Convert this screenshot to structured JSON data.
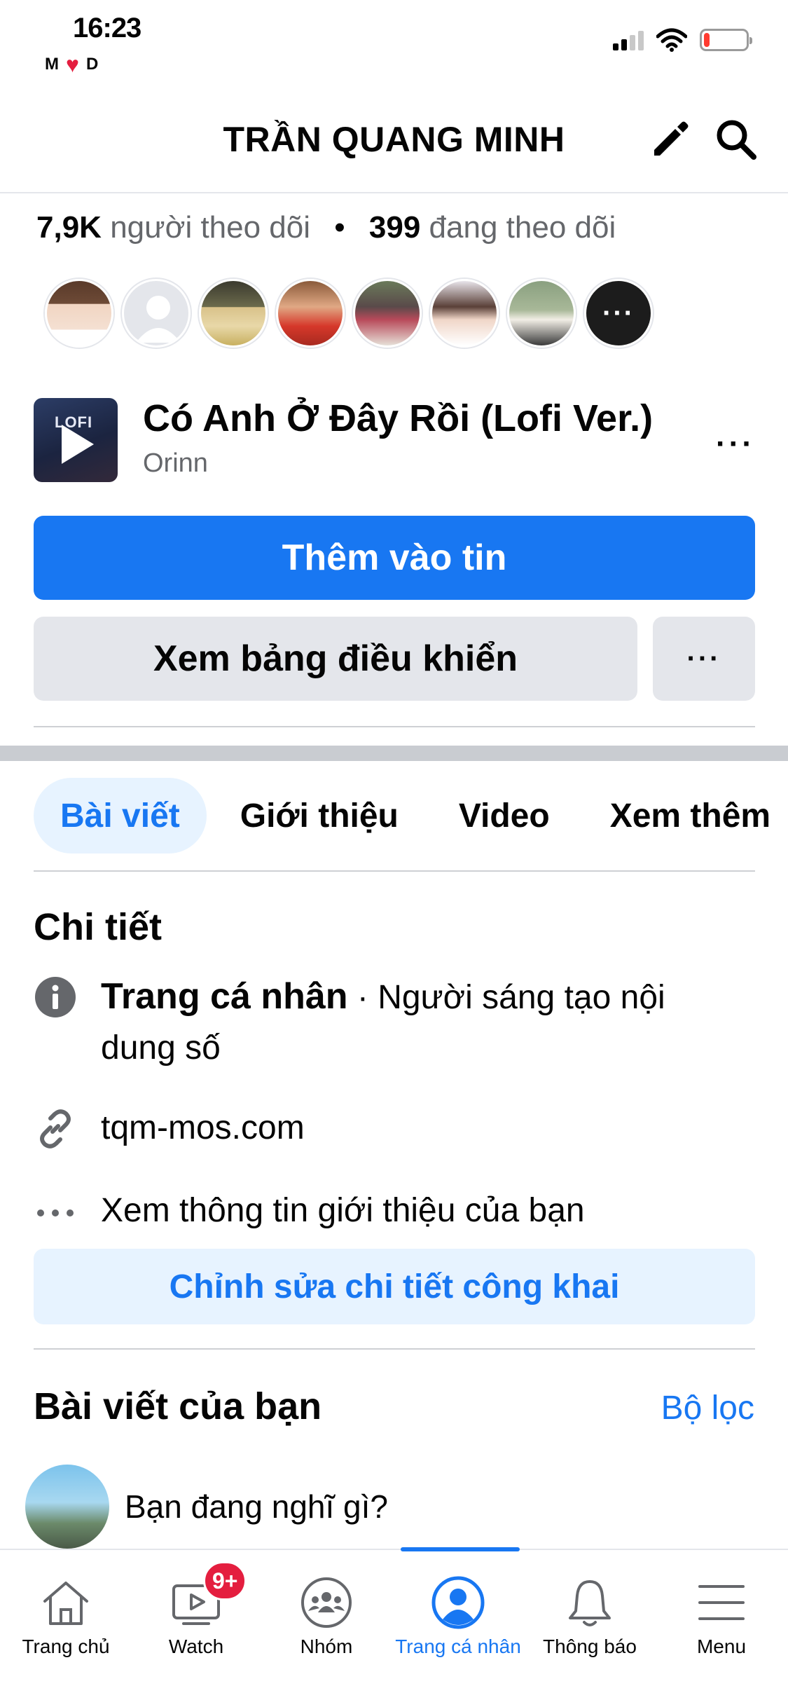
{
  "status_bar": {
    "time": "16:23",
    "sub_left": "M",
    "sub_right": "D",
    "battery_level": 0.12
  },
  "header": {
    "title": "TRẦN QUANG MINH",
    "edit_icon": "pencil-icon",
    "search_icon": "search-icon"
  },
  "stats": {
    "followers_count": "7,9K",
    "followers_label": "người theo dõi",
    "separator": "•",
    "following_count": "399",
    "following_label": "đang theo dõi"
  },
  "avatars": {
    "more_label": "···"
  },
  "music": {
    "art_label": "LOFI",
    "title": "Có Anh Ở Đây Rồi (Lofi Ver.)",
    "artist": "Orinn",
    "more_label": "···"
  },
  "buttons": {
    "add_to_story": "Thêm vào tin",
    "view_dashboard": "Xem bảng điều khiển",
    "more": "···"
  },
  "tabs": [
    {
      "label": "Bài viết",
      "active": true
    },
    {
      "label": "Giới thiệu",
      "active": false
    },
    {
      "label": "Video",
      "active": false
    },
    {
      "label": "Xem thêm",
      "active": false
    }
  ],
  "details": {
    "title": "Chi tiết",
    "profile_type_bold": "Trang cá nhân",
    "profile_type_rest": " · Người sáng tạo nội dung số",
    "website": "tqm-mos.com",
    "see_about": "Xem thông tin giới thiệu của bạn",
    "edit_button": "Chỉnh sửa chi tiết công khai"
  },
  "posts": {
    "title": "Bài viết của bạn",
    "filter": "Bộ lọc",
    "composer_placeholder": "Bạn đang nghĩ gì?"
  },
  "bottom_nav": {
    "items": [
      {
        "label": "Trang chủ",
        "icon": "home-icon"
      },
      {
        "label": "Watch",
        "icon": "watch-icon",
        "badge": "9+"
      },
      {
        "label": "Nhóm",
        "icon": "groups-icon"
      },
      {
        "label": "Trang cá nhân",
        "icon": "profile-icon",
        "active": true
      },
      {
        "label": "Thông báo",
        "icon": "bell-icon"
      },
      {
        "label": "Menu",
        "icon": "menu-icon"
      }
    ]
  },
  "colors": {
    "accent": "#1877f2",
    "badge": "#e41e3f",
    "secondary_button": "#e4e6eb",
    "light_blue_bg": "#e7f3ff"
  }
}
